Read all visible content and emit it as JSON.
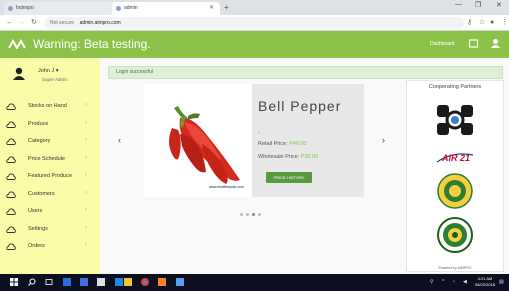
{
  "browser": {
    "tabs": [
      {
        "title": "Indexpo"
      },
      {
        "title": "admin"
      }
    ],
    "new_tab_icon": "plus-icon",
    "window_controls": [
      "—",
      "❐",
      "✕"
    ],
    "address": {
      "secure_text": "Not secure",
      "url": "admin.aimpro.com"
    }
  },
  "header": {
    "title": "Warning: Beta testing.",
    "dashboard_label": "Dashboard",
    "brand_color": "#8bc34a"
  },
  "user": {
    "name": "John J ▾",
    "role": "Super Admin"
  },
  "sidebar": {
    "background": "#fbfca8",
    "items": [
      {
        "label": "Stocks on Hand",
        "icon": "cloud-icon"
      },
      {
        "label": "Produce",
        "icon": "cloud-icon"
      },
      {
        "label": "Category",
        "icon": "cloud-icon"
      },
      {
        "label": "Price Schedule",
        "icon": "cloud-icon"
      },
      {
        "label": "Featured Produce",
        "icon": "cloud-icon"
      },
      {
        "label": "Customers",
        "icon": "cloud-icon"
      },
      {
        "label": "Users",
        "icon": "cloud-icon"
      },
      {
        "label": "Settings",
        "icon": "cloud-icon"
      },
      {
        "label": "Orders",
        "icon": "cloud-icon"
      }
    ]
  },
  "alert": {
    "text": "Login successful"
  },
  "carousel": {
    "product_name": "Bell Pepper",
    "dash": "-",
    "retail_label": "Retail Price:",
    "retail_price": "P40.00",
    "wholesale_label": "Wholesale Price:",
    "wholesale_price": "P30.00",
    "button_label": "PRICE HISTORY",
    "watermark": "www.shutterstock.com",
    "slide_count": 4,
    "active_slide": 2
  },
  "partners": {
    "title": "Cooperating Partners",
    "logos": [
      "doh-logo",
      "air21-logo",
      "university-seal-logo",
      "agency-seal-logo"
    ],
    "air21_text": "AIR 21",
    "powered_by": "Powered by AIMPRO"
  },
  "taskbar": {
    "time": "4:21 AM",
    "date": "08/22/2018"
  }
}
